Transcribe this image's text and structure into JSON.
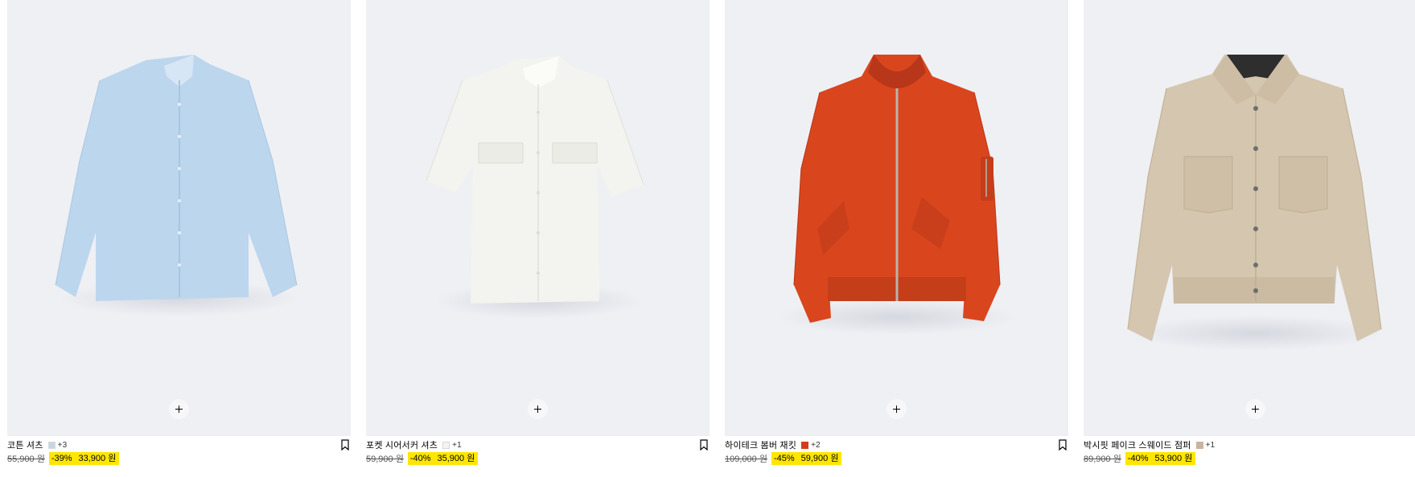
{
  "products": [
    {
      "name": "코튼 셔츠",
      "swatch_color": "#c6d6e8",
      "more_colors": "+3",
      "old_price": "55,900 원",
      "discount": "-39%",
      "sale_price": "33,900 원",
      "icon": "light-blue-shirt-image"
    },
    {
      "name": "포켓 시어서커 셔츠",
      "swatch_color": "#f4f3ee",
      "more_colors": "+1",
      "old_price": "59,900 원",
      "discount": "-40%",
      "sale_price": "35,900 원",
      "icon": "white-shirt-image"
    },
    {
      "name": "하이테크 봄버 재킷",
      "swatch_color": "#d43c1e",
      "more_colors": "+2",
      "old_price": "109,000 원",
      "discount": "-45%",
      "sale_price": "59,900 원",
      "icon": "orange-bomber-jacket-image"
    },
    {
      "name": "박시핏 페이크 스웨이드 점퍼",
      "swatch_color": "#c8b59b",
      "more_colors": "+1",
      "old_price": "89,900 원",
      "discount": "-40%",
      "sale_price": "53,900 원",
      "icon": "beige-suede-jacket-image"
    }
  ],
  "colors": {
    "image_bg": "#eff0f4",
    "sale_highlight": "#ffe600"
  }
}
